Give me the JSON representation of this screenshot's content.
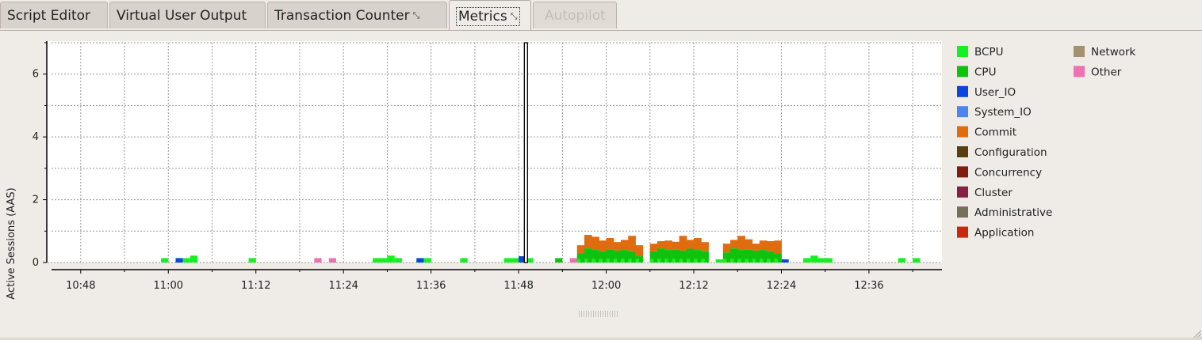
{
  "tabs": [
    {
      "label": "Script Editor",
      "state": "normal",
      "icon": ""
    },
    {
      "label": "Virtual User Output",
      "state": "normal",
      "icon": ""
    },
    {
      "label": "Transaction Counter",
      "state": "normal",
      "icon": "undock-icon"
    },
    {
      "label": "Metrics",
      "state": "active",
      "icon": "undock-icon"
    },
    {
      "label": "Autopilot",
      "state": "disabled",
      "icon": ""
    }
  ],
  "chart_data": {
    "type": "area",
    "ylabel": "Active Sessions (AAS)",
    "xlabel": "",
    "title": "",
    "ylim": [
      0,
      7
    ],
    "yticks": [
      "0",
      "2",
      "4",
      "6"
    ],
    "xlim": [
      "10:44",
      "12:46"
    ],
    "xticks": [
      "10:48",
      "11:00",
      "11:12",
      "11:24",
      "11:36",
      "11:48",
      "12:00",
      "12:12",
      "12:24",
      "12:36"
    ],
    "grid": true,
    "legend_position": "right",
    "cursor_time": "11:49",
    "series": [
      {
        "name": "BCPU",
        "color": "#14f020"
      },
      {
        "name": "CPU",
        "color": "#0ec20e"
      },
      {
        "name": "User_IO",
        "color": "#0a46dc"
      },
      {
        "name": "System_IO",
        "color": "#4d84f0"
      },
      {
        "name": "Commit",
        "color": "#e06c10"
      },
      {
        "name": "Configuration",
        "color": "#5a3d10"
      },
      {
        "name": "Concurrency",
        "color": "#821c0c"
      },
      {
        "name": "Cluster",
        "color": "#882044"
      },
      {
        "name": "Administrative",
        "color": "#74705a"
      },
      {
        "name": "Application",
        "color": "#c8280c"
      },
      {
        "name": "Network",
        "color": "#a29270"
      },
      {
        "name": "Other",
        "color": "#ec72b2"
      }
    ],
    "blocks": [
      [
        "10:59",
        "11:00",
        0,
        0.14,
        "BCPU"
      ],
      [
        "11:01",
        "11:02",
        0,
        0.14,
        "User_IO"
      ],
      [
        "11:02",
        "11:03",
        0,
        0.14,
        "BCPU"
      ],
      [
        "11:03",
        "11:04",
        0,
        0.22,
        "BCPU"
      ],
      [
        "11:11",
        "11:12",
        0,
        0.14,
        "BCPU"
      ],
      [
        "11:20",
        "11:21",
        0,
        0.14,
        "Other"
      ],
      [
        "11:22",
        "11:23",
        0,
        0.14,
        "Other"
      ],
      [
        "11:28",
        "11:30",
        0,
        0.14,
        "BCPU"
      ],
      [
        "11:30",
        "11:31",
        0,
        0.22,
        "BCPU"
      ],
      [
        "11:31",
        "11:32",
        0,
        0.14,
        "BCPU"
      ],
      [
        "11:34",
        "11:35",
        0,
        0.14,
        "User_IO"
      ],
      [
        "11:35",
        "11:36",
        0,
        0.14,
        "BCPU"
      ],
      [
        "11:40",
        "11:41",
        0,
        0.14,
        "BCPU"
      ],
      [
        "11:46",
        "11:48",
        0,
        0.14,
        "BCPU"
      ],
      [
        "11:48",
        "11:49",
        0,
        0.2,
        "User_IO"
      ],
      [
        "11:49",
        "11:50",
        0,
        0.14,
        "BCPU"
      ],
      [
        "11:53",
        "11:54",
        0,
        0.14,
        "CPU"
      ],
      [
        "11:55",
        "11:56",
        0,
        0.14,
        "Other"
      ],
      [
        "11:56",
        "11:57",
        0,
        0.2,
        "BCPU"
      ],
      [
        "11:57",
        "11:58",
        0,
        0.1,
        "Other"
      ],
      [
        "12:08",
        "12:09",
        0,
        0.14,
        "BCPU"
      ],
      [
        "12:13",
        "12:14",
        0,
        0.14,
        "BCPU"
      ],
      [
        "12:15",
        "12:16",
        0,
        0.1,
        "BCPU"
      ],
      [
        "12:24",
        "12:25",
        0,
        0.1,
        "User_IO"
      ],
      [
        "12:27",
        "12:28",
        0,
        0.14,
        "BCPU"
      ],
      [
        "12:28",
        "12:29",
        0,
        0.22,
        "BCPU"
      ],
      [
        "12:29",
        "12:30",
        0,
        0.14,
        "BCPU"
      ],
      [
        "12:30",
        "12:31",
        0,
        0.14,
        "BCPU"
      ],
      [
        "12:40",
        "12:41",
        0,
        0.14,
        "BCPU"
      ],
      [
        "12:42",
        "12:43",
        0,
        0.14,
        "BCPU"
      ]
    ],
    "stacks": [
      {
        "start": "11:56",
        "end": "12:04",
        "color_cpu": "#0ec20e",
        "color_bcpu": "#14f020",
        "color_commit": "#e06c10",
        "cpu": [
          0.3,
          0.45,
          0.4,
          0.35,
          0.42,
          0.38,
          0.4,
          0.36
        ],
        "commit": [
          0.55,
          0.88,
          0.82,
          0.7,
          0.78,
          0.65,
          0.72,
          0.85
        ]
      },
      {
        "start": "12:04",
        "end": "12:05",
        "cpu": [
          0.2
        ],
        "commit": [
          0.55
        ]
      },
      {
        "start": "12:06",
        "end": "12:14",
        "cpu": [
          0.35,
          0.45,
          0.4,
          0.42,
          0.38,
          0.44,
          0.4,
          0.36
        ],
        "commit": [
          0.6,
          0.68,
          0.7,
          0.66,
          0.85,
          0.72,
          0.78,
          0.65
        ]
      },
      {
        "start": "12:16",
        "end": "12:24",
        "cpu": [
          0.32,
          0.45,
          0.4,
          0.42,
          0.38,
          0.4,
          0.36,
          0.3
        ],
        "commit": [
          0.6,
          0.72,
          0.85,
          0.74,
          0.6,
          0.7,
          0.68,
          0.7
        ]
      }
    ]
  }
}
